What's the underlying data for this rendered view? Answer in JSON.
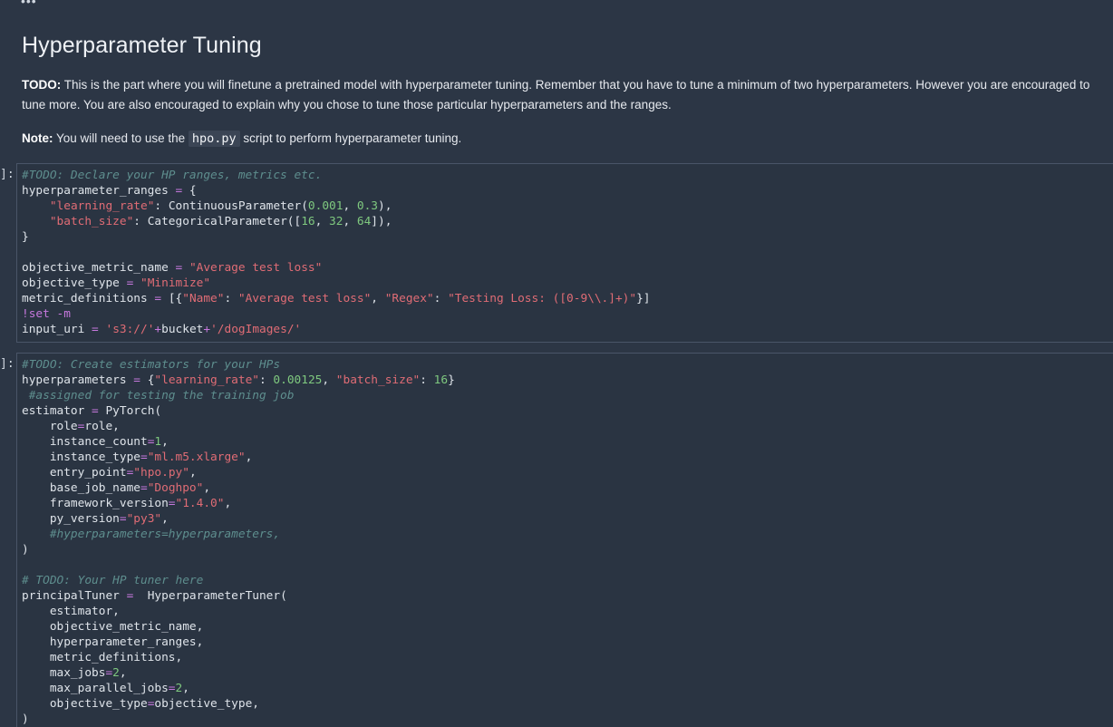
{
  "top": {
    "dots": "•••"
  },
  "markdown": {
    "title": "Hyperparameter Tuning",
    "todo_label": "TODO:",
    "todo_text": " This is the part where you will finetune a pretrained model with hyperparameter tuning. Remember that you have to tune a minimum of two hyperparameters. However you are encouraged to tune more. You are also encouraged to explain why you chose to tune those particular hyperparameters and the ranges.",
    "note_label": "Note:",
    "note_text_before": " You will need to use the ",
    "note_code": "hpo.py",
    "note_text_after": " script to perform hyperparameter tuning."
  },
  "cells": [
    {
      "prompt": "]:",
      "lines": [
        "#TODO: Declare your HP ranges, metrics etc.",
        "hyperparameter_ranges = {",
        "    \"learning_rate\": ContinuousParameter(0.001, 0.3),",
        "    \"batch_size\": CategoricalParameter([16, 32, 64]),",
        "}",
        "",
        "objective_metric_name = \"Average test loss\"",
        "objective_type = \"Minimize\"",
        "metric_definitions = [{\"Name\": \"Average test loss\", \"Regex\": \"Testing Loss: ([0-9\\\\.]+)\"}]",
        "!set -m",
        "input_uri = 's3://'+bucket+'/dogImages/'"
      ]
    },
    {
      "prompt": "]:",
      "lines": [
        "#TODO: Create estimators for your HPs",
        "hyperparameters = {\"learning_rate\": 0.00125, \"batch_size\": 16}",
        " #assigned for testing the training job",
        "estimator = PyTorch(",
        "    role=role,",
        "    instance_count=1,",
        "    instance_type=\"ml.m5.xlarge\",",
        "    entry_point=\"hpo.py\",",
        "    base_job_name=\"Doghpo\",",
        "    framework_version=\"1.4.0\",",
        "    py_version=\"py3\",",
        "    #hyperparameters=hyperparameters,",
        ")",
        "",
        "# TODO: Your HP tuner here",
        "principalTuner =  HyperparameterTuner(",
        "    estimator,",
        "    objective_metric_name,",
        "    hyperparameter_ranges,",
        "    metric_definitions,",
        "    max_jobs=2,",
        "    max_parallel_jobs=2,",
        "    objective_type=objective_type,",
        ")"
      ]
    }
  ]
}
